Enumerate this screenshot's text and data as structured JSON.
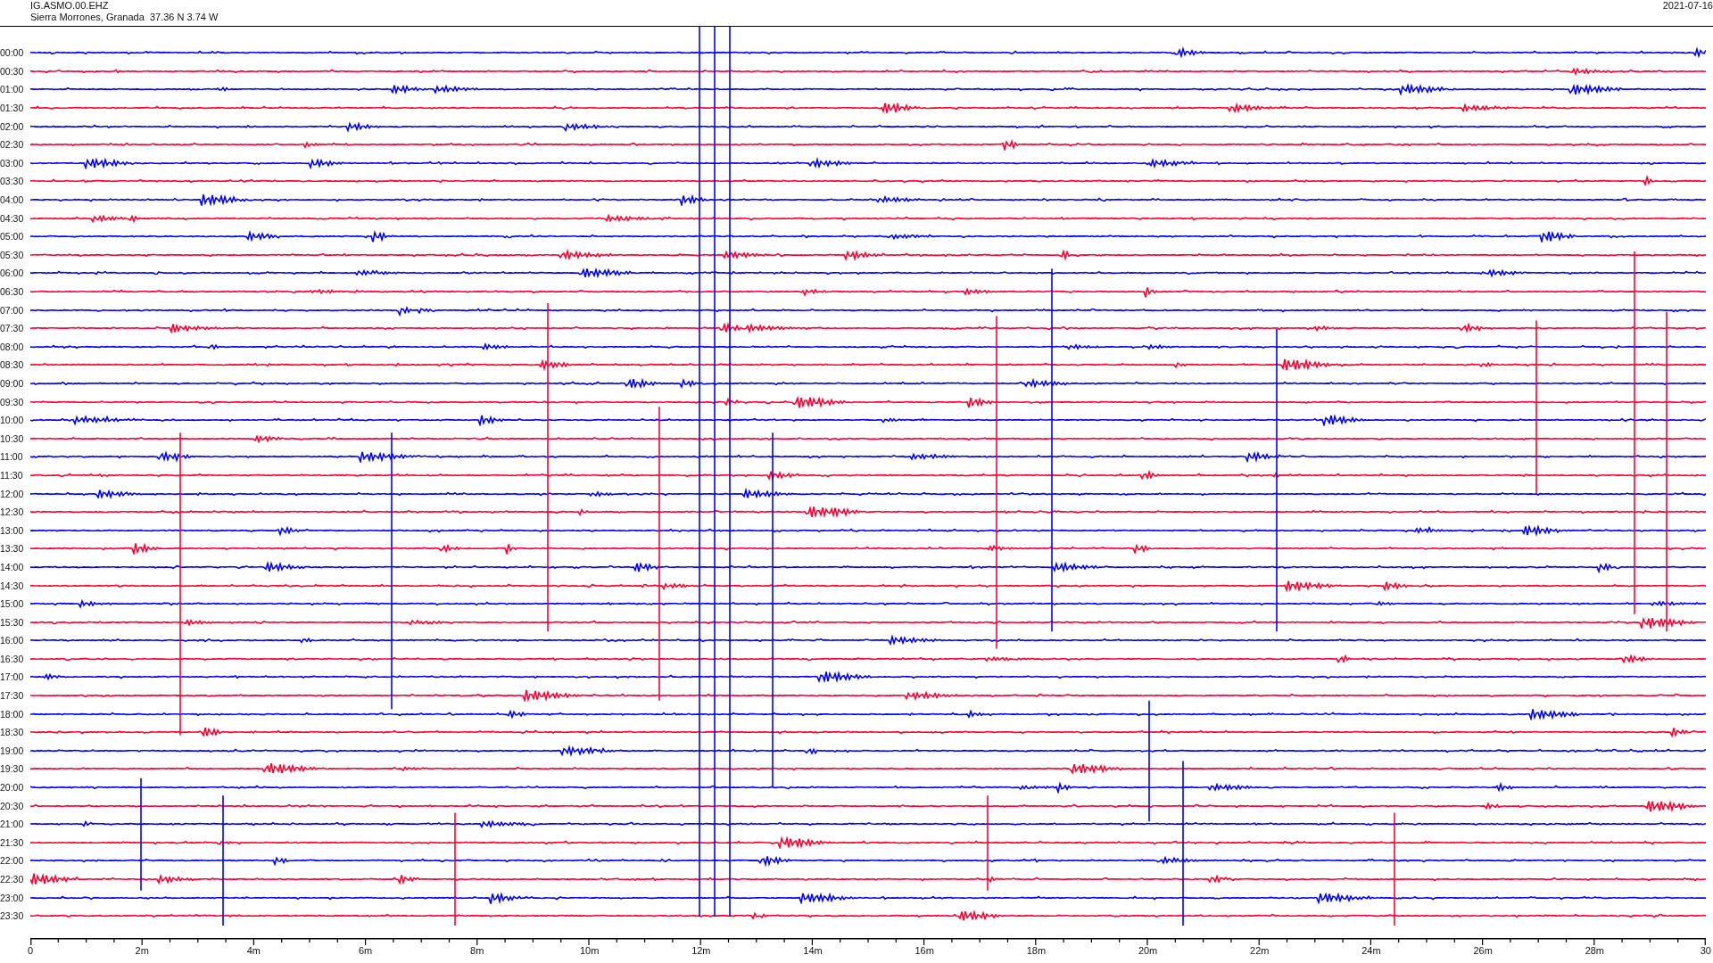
{
  "header": {
    "station": "IG.ASMO.00.EHZ",
    "location": "Sierra Morrones, Granada  37.36 N 3.74 W",
    "date": "2021-07-16"
  },
  "traces": [
    {
      "label": "00:00",
      "color": "#0000ff"
    },
    {
      "label": "00:30",
      "color": "#ff0033"
    },
    {
      "label": "01:00",
      "color": "#0000ff"
    },
    {
      "label": "01:30",
      "color": "#ff0033"
    },
    {
      "label": "02:00",
      "color": "#0000ff"
    },
    {
      "label": "02:30",
      "color": "#ff0033"
    },
    {
      "label": "03:00",
      "color": "#0000ff"
    },
    {
      "label": "03:30",
      "color": "#ff0033"
    },
    {
      "label": "04:00",
      "color": "#0000ff"
    },
    {
      "label": "04:30",
      "color": "#ff0033"
    },
    {
      "label": "05:00",
      "color": "#0000ff"
    },
    {
      "label": "05:30",
      "color": "#ff0033"
    },
    {
      "label": "06:00",
      "color": "#0000ff"
    },
    {
      "label": "06:30",
      "color": "#ff0033"
    },
    {
      "label": "07:00",
      "color": "#0000ff"
    },
    {
      "label": "07:30",
      "color": "#ff0033"
    },
    {
      "label": "08:00",
      "color": "#0000ff"
    },
    {
      "label": "08:30",
      "color": "#ff0033"
    },
    {
      "label": "09:00",
      "color": "#0000ff"
    },
    {
      "label": "09:30",
      "color": "#ff0033"
    },
    {
      "label": "10:00",
      "color": "#0000ff"
    },
    {
      "label": "10:30",
      "color": "#ff0033"
    },
    {
      "label": "11:00",
      "color": "#0000ff"
    },
    {
      "label": "11:30",
      "color": "#ff0033"
    },
    {
      "label": "12:00",
      "color": "#0000ff"
    },
    {
      "label": "12:30",
      "color": "#ff0033"
    },
    {
      "label": "13:00",
      "color": "#0000ff"
    },
    {
      "label": "13:30",
      "color": "#ff0033"
    },
    {
      "label": "14:00",
      "color": "#0000ff"
    },
    {
      "label": "14:30",
      "color": "#ff0033"
    },
    {
      "label": "15:00",
      "color": "#0000ff"
    },
    {
      "label": "15:30",
      "color": "#ff0033"
    },
    {
      "label": "16:00",
      "color": "#0000ff"
    },
    {
      "label": "16:30",
      "color": "#ff0033"
    },
    {
      "label": "17:00",
      "color": "#0000ff"
    },
    {
      "label": "17:30",
      "color": "#ff0033"
    },
    {
      "label": "18:00",
      "color": "#0000ff"
    },
    {
      "label": "18:30",
      "color": "#ff0033"
    },
    {
      "label": "19:00",
      "color": "#0000ff"
    },
    {
      "label": "19:30",
      "color": "#ff0033"
    },
    {
      "label": "20:00",
      "color": "#0000ff"
    },
    {
      "label": "20:30",
      "color": "#ff0033"
    },
    {
      "label": "21:00",
      "color": "#0000ff"
    },
    {
      "label": "21:30",
      "color": "#ff0033"
    },
    {
      "label": "22:00",
      "color": "#0000ff"
    },
    {
      "label": "22:30",
      "color": "#ff0033"
    },
    {
      "label": "23:00",
      "color": "#0000ff"
    },
    {
      "label": "23:30",
      "color": "#ff0033"
    }
  ],
  "axis": {
    "ticks": [
      "0",
      "2m",
      "4m",
      "6m",
      "8m",
      "10m",
      "12m",
      "14m",
      "16m",
      "18m",
      "20m",
      "22m",
      "24m",
      "26m",
      "28m",
      "30"
    ]
  }
}
